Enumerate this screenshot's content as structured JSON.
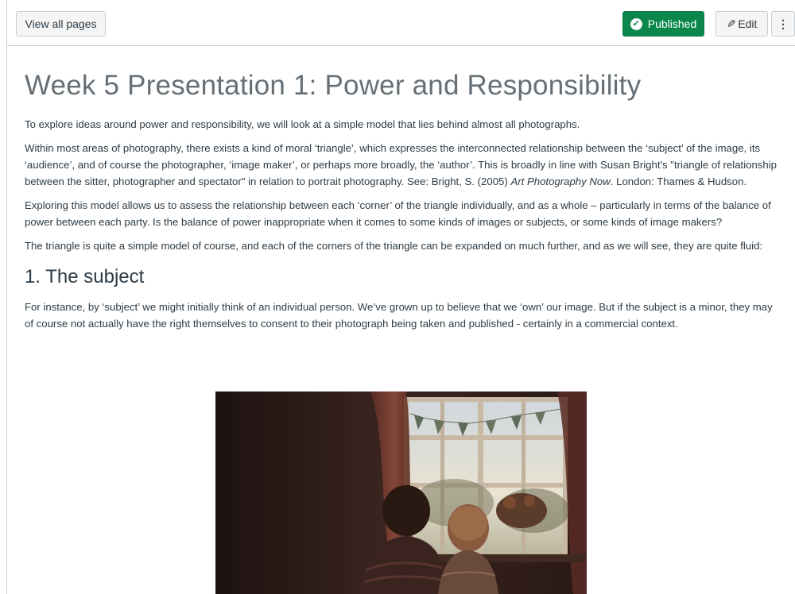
{
  "toolbar": {
    "view_all_label": "View all pages",
    "published_label": "Published",
    "edit_label": "Edit",
    "more_label": "⋮"
  },
  "page": {
    "title": "Week 5 Presentation 1: Power and Responsibility",
    "para1": "To explore ideas around power and responsibility, we will look at a simple model that lies behind almost all photographs.",
    "para2_before": "Within most areas of photography, there exists a kind of moral ‘triangle’, which expresses the interconnected relationship between the ‘subject’ of the image, its ‘audience’, and of course the photographer, ‘image maker’, or perhaps more broadly, the ‘author’. This is broadly in line with Susan Bright's \"triangle of relationship between the sitter, photographer and spectator\" in relation to portrait photography. See: Bright, S. (2005) ",
    "para2_italic": "Art Photography Now",
    "para2_after": ". London: Thames & Hudson.",
    "para3": "Exploring this model allows us to assess the relationship between each ‘corner’ of the triangle individually, and as a whole – particularly in terms of the balance of power between each party. Is the balance of power inappropriate when it comes to some kinds of images or subjects, or some kinds of image makers?",
    "para4": "The triangle is quite a simple model of course, and each of the corners of the triangle can be expanded on much further, and as we will see, they are quite fluid:",
    "section1_heading": "1. The subject",
    "para5": "For instance, by ‘subject’ we might initially think of an individual person. We’ve grown up to believe that we ‘own’ our image. But if the subject is a minor, they may of course not actually have the right themselves to consent to their photograph being taken and published - certainly in a commercial context."
  },
  "colors": {
    "published_green": "#0b874b",
    "text": "#2d3b45",
    "border": "#c7cdd1"
  }
}
